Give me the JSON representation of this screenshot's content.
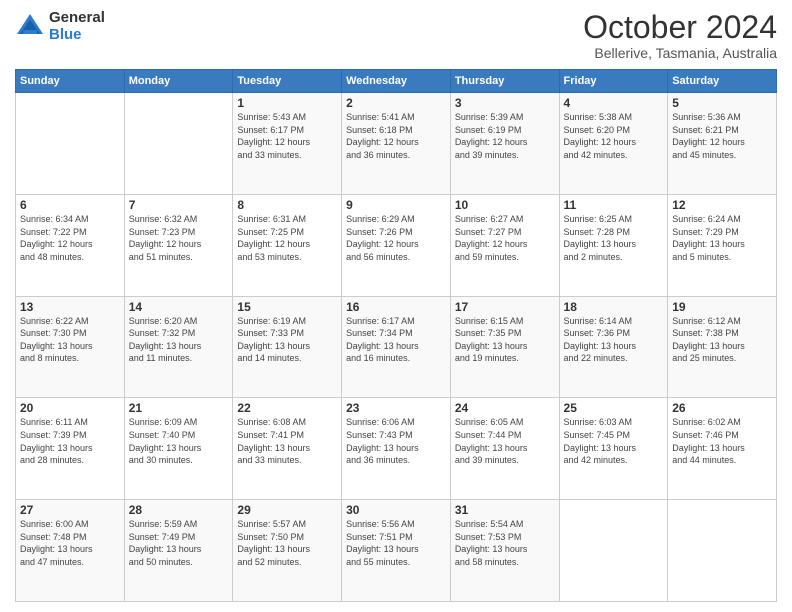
{
  "logo": {
    "general": "General",
    "blue": "Blue"
  },
  "title": "October 2024",
  "subtitle": "Bellerive, Tasmania, Australia",
  "days_of_week": [
    "Sunday",
    "Monday",
    "Tuesday",
    "Wednesday",
    "Thursday",
    "Friday",
    "Saturday"
  ],
  "weeks": [
    [
      {
        "day": "",
        "info": ""
      },
      {
        "day": "",
        "info": ""
      },
      {
        "day": "1",
        "info": "Sunrise: 5:43 AM\nSunset: 6:17 PM\nDaylight: 12 hours\nand 33 minutes."
      },
      {
        "day": "2",
        "info": "Sunrise: 5:41 AM\nSunset: 6:18 PM\nDaylight: 12 hours\nand 36 minutes."
      },
      {
        "day": "3",
        "info": "Sunrise: 5:39 AM\nSunset: 6:19 PM\nDaylight: 12 hours\nand 39 minutes."
      },
      {
        "day": "4",
        "info": "Sunrise: 5:38 AM\nSunset: 6:20 PM\nDaylight: 12 hours\nand 42 minutes."
      },
      {
        "day": "5",
        "info": "Sunrise: 5:36 AM\nSunset: 6:21 PM\nDaylight: 12 hours\nand 45 minutes."
      }
    ],
    [
      {
        "day": "6",
        "info": "Sunrise: 6:34 AM\nSunset: 7:22 PM\nDaylight: 12 hours\nand 48 minutes."
      },
      {
        "day": "7",
        "info": "Sunrise: 6:32 AM\nSunset: 7:23 PM\nDaylight: 12 hours\nand 51 minutes."
      },
      {
        "day": "8",
        "info": "Sunrise: 6:31 AM\nSunset: 7:25 PM\nDaylight: 12 hours\nand 53 minutes."
      },
      {
        "day": "9",
        "info": "Sunrise: 6:29 AM\nSunset: 7:26 PM\nDaylight: 12 hours\nand 56 minutes."
      },
      {
        "day": "10",
        "info": "Sunrise: 6:27 AM\nSunset: 7:27 PM\nDaylight: 12 hours\nand 59 minutes."
      },
      {
        "day": "11",
        "info": "Sunrise: 6:25 AM\nSunset: 7:28 PM\nDaylight: 13 hours\nand 2 minutes."
      },
      {
        "day": "12",
        "info": "Sunrise: 6:24 AM\nSunset: 7:29 PM\nDaylight: 13 hours\nand 5 minutes."
      }
    ],
    [
      {
        "day": "13",
        "info": "Sunrise: 6:22 AM\nSunset: 7:30 PM\nDaylight: 13 hours\nand 8 minutes."
      },
      {
        "day": "14",
        "info": "Sunrise: 6:20 AM\nSunset: 7:32 PM\nDaylight: 13 hours\nand 11 minutes."
      },
      {
        "day": "15",
        "info": "Sunrise: 6:19 AM\nSunset: 7:33 PM\nDaylight: 13 hours\nand 14 minutes."
      },
      {
        "day": "16",
        "info": "Sunrise: 6:17 AM\nSunset: 7:34 PM\nDaylight: 13 hours\nand 16 minutes."
      },
      {
        "day": "17",
        "info": "Sunrise: 6:15 AM\nSunset: 7:35 PM\nDaylight: 13 hours\nand 19 minutes."
      },
      {
        "day": "18",
        "info": "Sunrise: 6:14 AM\nSunset: 7:36 PM\nDaylight: 13 hours\nand 22 minutes."
      },
      {
        "day": "19",
        "info": "Sunrise: 6:12 AM\nSunset: 7:38 PM\nDaylight: 13 hours\nand 25 minutes."
      }
    ],
    [
      {
        "day": "20",
        "info": "Sunrise: 6:11 AM\nSunset: 7:39 PM\nDaylight: 13 hours\nand 28 minutes."
      },
      {
        "day": "21",
        "info": "Sunrise: 6:09 AM\nSunset: 7:40 PM\nDaylight: 13 hours\nand 30 minutes."
      },
      {
        "day": "22",
        "info": "Sunrise: 6:08 AM\nSunset: 7:41 PM\nDaylight: 13 hours\nand 33 minutes."
      },
      {
        "day": "23",
        "info": "Sunrise: 6:06 AM\nSunset: 7:43 PM\nDaylight: 13 hours\nand 36 minutes."
      },
      {
        "day": "24",
        "info": "Sunrise: 6:05 AM\nSunset: 7:44 PM\nDaylight: 13 hours\nand 39 minutes."
      },
      {
        "day": "25",
        "info": "Sunrise: 6:03 AM\nSunset: 7:45 PM\nDaylight: 13 hours\nand 42 minutes."
      },
      {
        "day": "26",
        "info": "Sunrise: 6:02 AM\nSunset: 7:46 PM\nDaylight: 13 hours\nand 44 minutes."
      }
    ],
    [
      {
        "day": "27",
        "info": "Sunrise: 6:00 AM\nSunset: 7:48 PM\nDaylight: 13 hours\nand 47 minutes."
      },
      {
        "day": "28",
        "info": "Sunrise: 5:59 AM\nSunset: 7:49 PM\nDaylight: 13 hours\nand 50 minutes."
      },
      {
        "day": "29",
        "info": "Sunrise: 5:57 AM\nSunset: 7:50 PM\nDaylight: 13 hours\nand 52 minutes."
      },
      {
        "day": "30",
        "info": "Sunrise: 5:56 AM\nSunset: 7:51 PM\nDaylight: 13 hours\nand 55 minutes."
      },
      {
        "day": "31",
        "info": "Sunrise: 5:54 AM\nSunset: 7:53 PM\nDaylight: 13 hours\nand 58 minutes."
      },
      {
        "day": "",
        "info": ""
      },
      {
        "day": "",
        "info": ""
      }
    ]
  ]
}
